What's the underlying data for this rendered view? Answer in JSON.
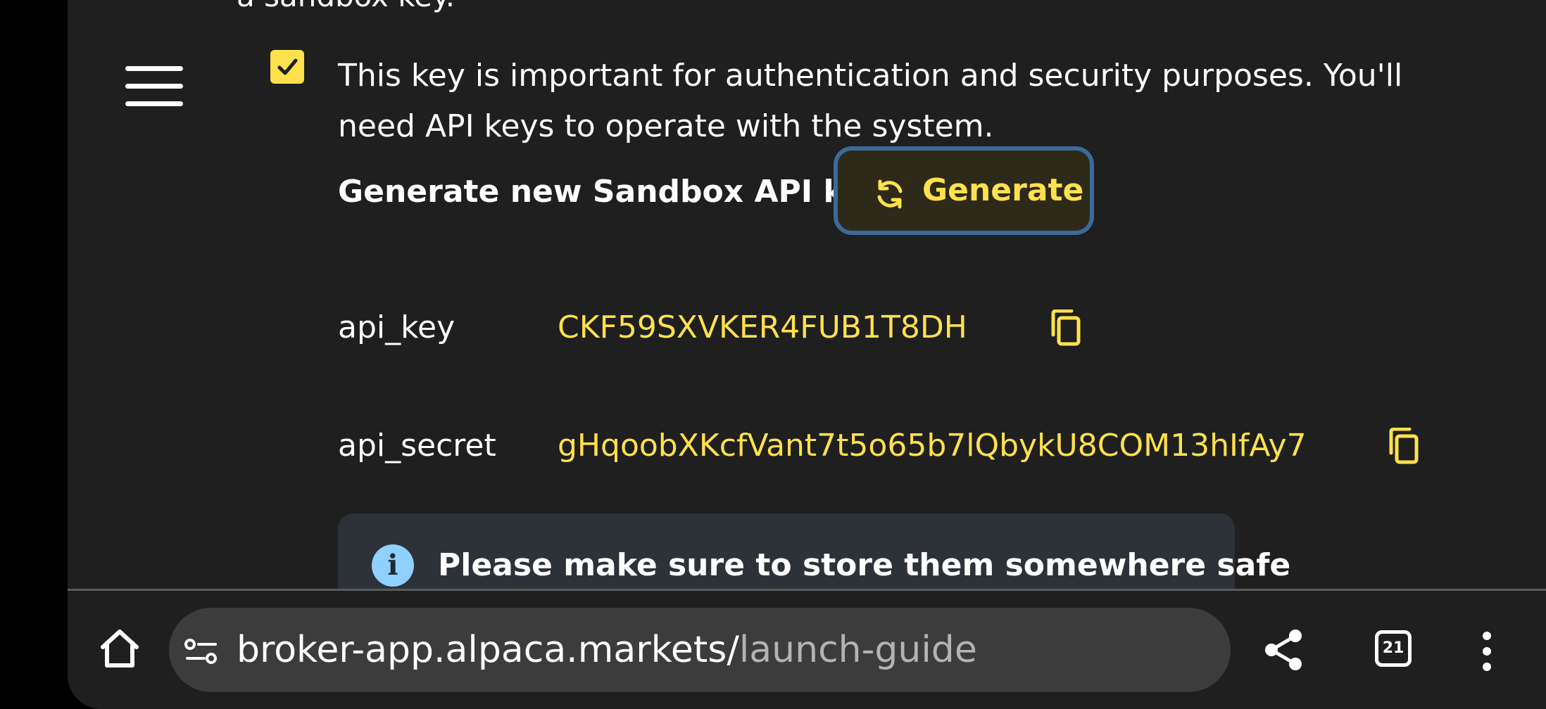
{
  "page": {
    "cutoff_text": "a sandbox key.",
    "checkbox_checked": true,
    "description": "This key is important for authentication and security purposes. You'll need API keys to operate with the system.",
    "generate_label": "Generate new Sandbox API keys",
    "generate_button": "Generate",
    "api_key_label": "api_key",
    "api_key_value": "CKF59SXVKER4FUB1T8DH",
    "api_secret_label": "api_secret",
    "api_secret_value": "gHqoobXKcfVant7t5o65b7lQbykU8COM13hIfAy7",
    "notice_text": "Please make sure to store them somewhere safe",
    "colors": {
      "accent": "#ffe14d",
      "background": "#1f1f1f",
      "button_border": "#3a6b99",
      "info_icon": "#8fd0ff"
    }
  },
  "browser": {
    "url_host": "broker-app.alpaca.markets/",
    "url_path": "launch-guide",
    "tab_count": "21",
    "icons": [
      "home-icon",
      "site-settings-icon",
      "share-icon",
      "tabs-icon",
      "more-icon"
    ]
  }
}
